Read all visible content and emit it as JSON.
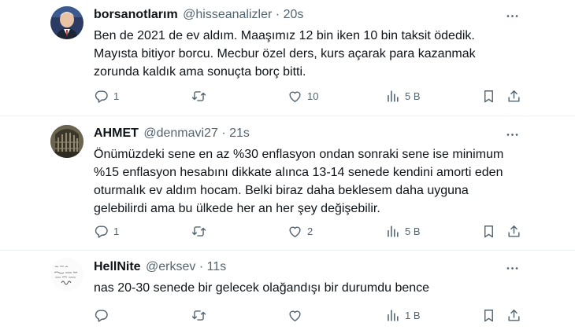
{
  "tweets": [
    {
      "name": "borsanotlarım",
      "handle": "@hisseanalizler",
      "dot": "·",
      "time": "20s",
      "lines": [
        "Ben de 2021 de ev aldım. Maaşımız 12 bin iken 10 bin taksit ödedik.",
        "Mayısta bitiyor borcu. Mecbur özel ders, kurs açarak para kazanmak",
        "zorunda kaldık ama sonuçta borç bitti."
      ],
      "replies": "1",
      "retweets": "",
      "likes": "10",
      "views": "5 B"
    },
    {
      "name": "AHMET",
      "handle": "@denmavi27",
      "dot": "·",
      "time": "21s",
      "lines": [
        "Önümüzdeki sene  en az %30 enflasyon  ondan sonraki sene ise minimum",
        "%15 enflasyon hesabını dikkate alınca 13-14 senede kendini amorti eden",
        "oturmalık ev aldım hocam. Belki biraz daha beklesem daha uyguna",
        "gelebilirdi ama bu ülkede her an her şey değişebilir."
      ],
      "replies": "1",
      "retweets": "",
      "likes": "2",
      "views": "5 B"
    },
    {
      "name": "HellNite",
      "handle": "@erksev",
      "dot": "·",
      "time": "11s",
      "lines": [
        "nas 20-30 senede bir gelecek olağandışı bir durumdu bence"
      ],
      "replies": "",
      "retweets": "",
      "likes": "",
      "views": "1 B"
    }
  ],
  "icons": {
    "reply": "reply-icon",
    "retweet": "retweet-icon",
    "like": "heart-icon",
    "views": "views-icon",
    "bookmark": "bookmark-icon",
    "share": "share-icon",
    "more": "more-icon"
  },
  "colors": {
    "text": "#0f1419",
    "secondary": "#536471",
    "divider": "#eff3f4"
  }
}
